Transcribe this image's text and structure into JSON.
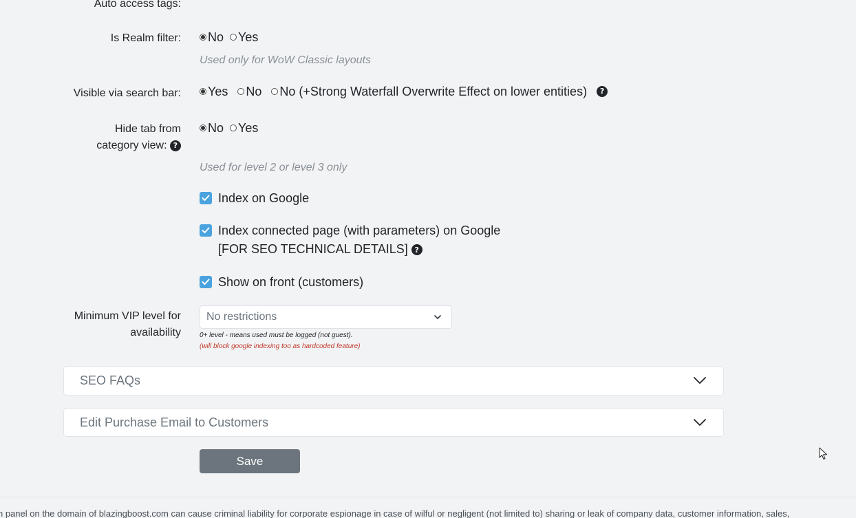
{
  "fields": {
    "auto_access_tags_label": "Auto access tags:",
    "realm_filter": {
      "label": "Is Realm filter:",
      "options": [
        "No",
        "Yes"
      ],
      "selected": "No",
      "hint": "Used only for WoW Classic layouts"
    },
    "visible_search": {
      "label": "Visible via search bar:",
      "options": [
        "Yes",
        "No",
        "No (+Strong Waterfall Overwrite Effect on lower entities)"
      ],
      "selected": "Yes"
    },
    "hide_tab": {
      "label_line1": "Hide tab from",
      "label_line2": "category view:",
      "options": [
        "No",
        "Yes"
      ],
      "selected": "No",
      "hint": "Used for level 2 or level 3 only"
    },
    "checkboxes": {
      "index_google": "Index on Google",
      "index_connected_line1": "Index connected page (with parameters) on Google",
      "index_connected_line2": "[FOR SEO TECHNICAL DETAILS]",
      "show_front": "Show on front (customers)"
    },
    "vip": {
      "label_line1": "Minimum VIP level for",
      "label_line2": "availability",
      "selected": "No restrictions",
      "note1": "0+ level - means used must be logged (not guest).",
      "note2": "(will block google indexing too as hardcoded feature)"
    }
  },
  "accordions": {
    "seo_faqs": "SEO FAQs",
    "purchase_email": "Edit Purchase Email to Customers"
  },
  "actions": {
    "save": "Save"
  },
  "footer": {
    "text": "n panel on the domain of blazingboost.com can cause criminal liability for corporate espionage in case of wilful or negligent (not limited to) sharing or leak of company data, customer information, sales,"
  },
  "colors": {
    "accent_checkbox": "#4aa3df",
    "save_button": "#6c757d",
    "warning_note": "#c0392b",
    "background": "#f2f3f4"
  },
  "icons": {
    "help": "question-circle-icon",
    "select_chevron": "chevron-down-icon",
    "cursor": "mouse-pointer-icon"
  }
}
